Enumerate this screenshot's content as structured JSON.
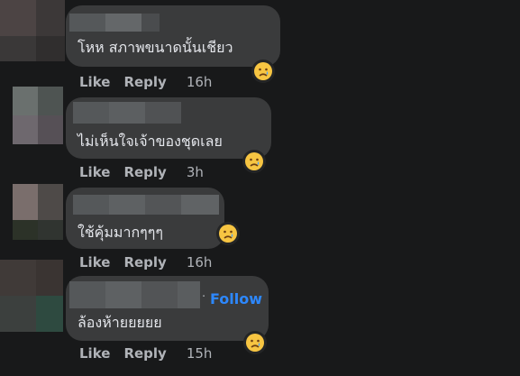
{
  "comments": [
    {
      "text": "โหห สภาพขนาดนั้นเชียว",
      "like": "Like",
      "reply": "Reply",
      "time": "16h",
      "reaction": "sad-icon"
    },
    {
      "text": "ไม่เห็นใจเจ้าของชุดเลย",
      "like": "Like",
      "reply": "Reply",
      "time": "3h",
      "reaction": "sad-icon"
    },
    {
      "text": "ใช้คุ้มมากๆๆๆ",
      "like": "Like",
      "reply": "Reply",
      "time": "16h",
      "reaction": "sad-icon"
    },
    {
      "text": "ล้องห้ายยยยย",
      "like": "Like",
      "reply": "Reply",
      "time": "15h",
      "reaction": "sad-icon",
      "follow": "Follow",
      "follow_sep": "·"
    }
  ],
  "colors": {
    "bubble": "#3a3b3c",
    "background": "#18191a",
    "follow": "#2d88ff",
    "meta": "#b0b3b8"
  }
}
